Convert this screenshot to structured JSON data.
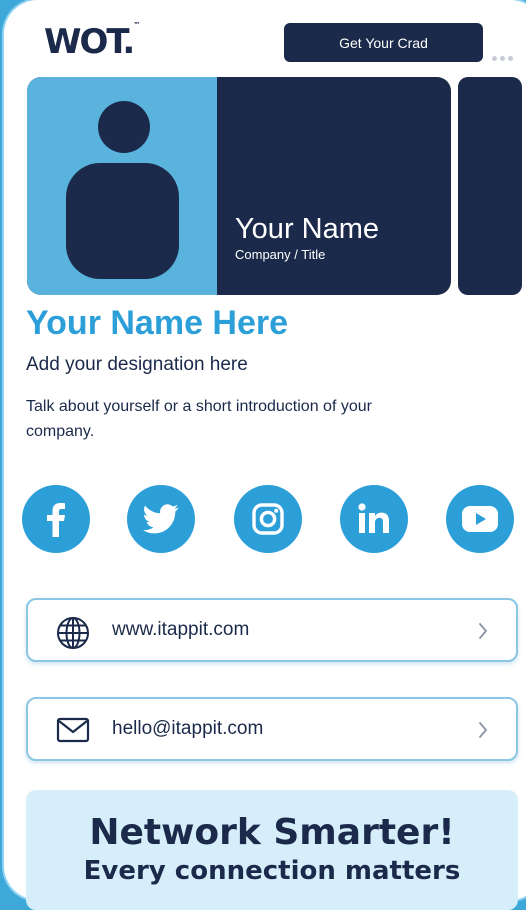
{
  "header": {
    "logo_text": "WOT.",
    "logo_mark": "™",
    "cta_label": "Get Your Crad"
  },
  "hero": {
    "name": "Your Name",
    "title": "Company / Title"
  },
  "profile": {
    "name": "Your Name Here",
    "designation": "Add your designation here",
    "intro": "Talk about yourself or a short introduction of your company."
  },
  "social": [
    {
      "icon": "facebook-icon"
    },
    {
      "icon": "twitter-icon"
    },
    {
      "icon": "instagram-icon"
    },
    {
      "icon": "linkedin-icon"
    },
    {
      "icon": "youtube-icon"
    }
  ],
  "links": {
    "website": {
      "icon": "globe-icon",
      "text": "www.itappit.com"
    },
    "email": {
      "icon": "mail-icon",
      "text": "hello@itappit.com"
    }
  },
  "banner": {
    "title": "Network Smarter!",
    "subtitle": "Every connection matters"
  },
  "colors": {
    "navy": "#1b2a4a",
    "accent_blue": "#2c9fd9",
    "light_blue": "#5ab3dc",
    "banner_bg": "#d5eef9"
  }
}
